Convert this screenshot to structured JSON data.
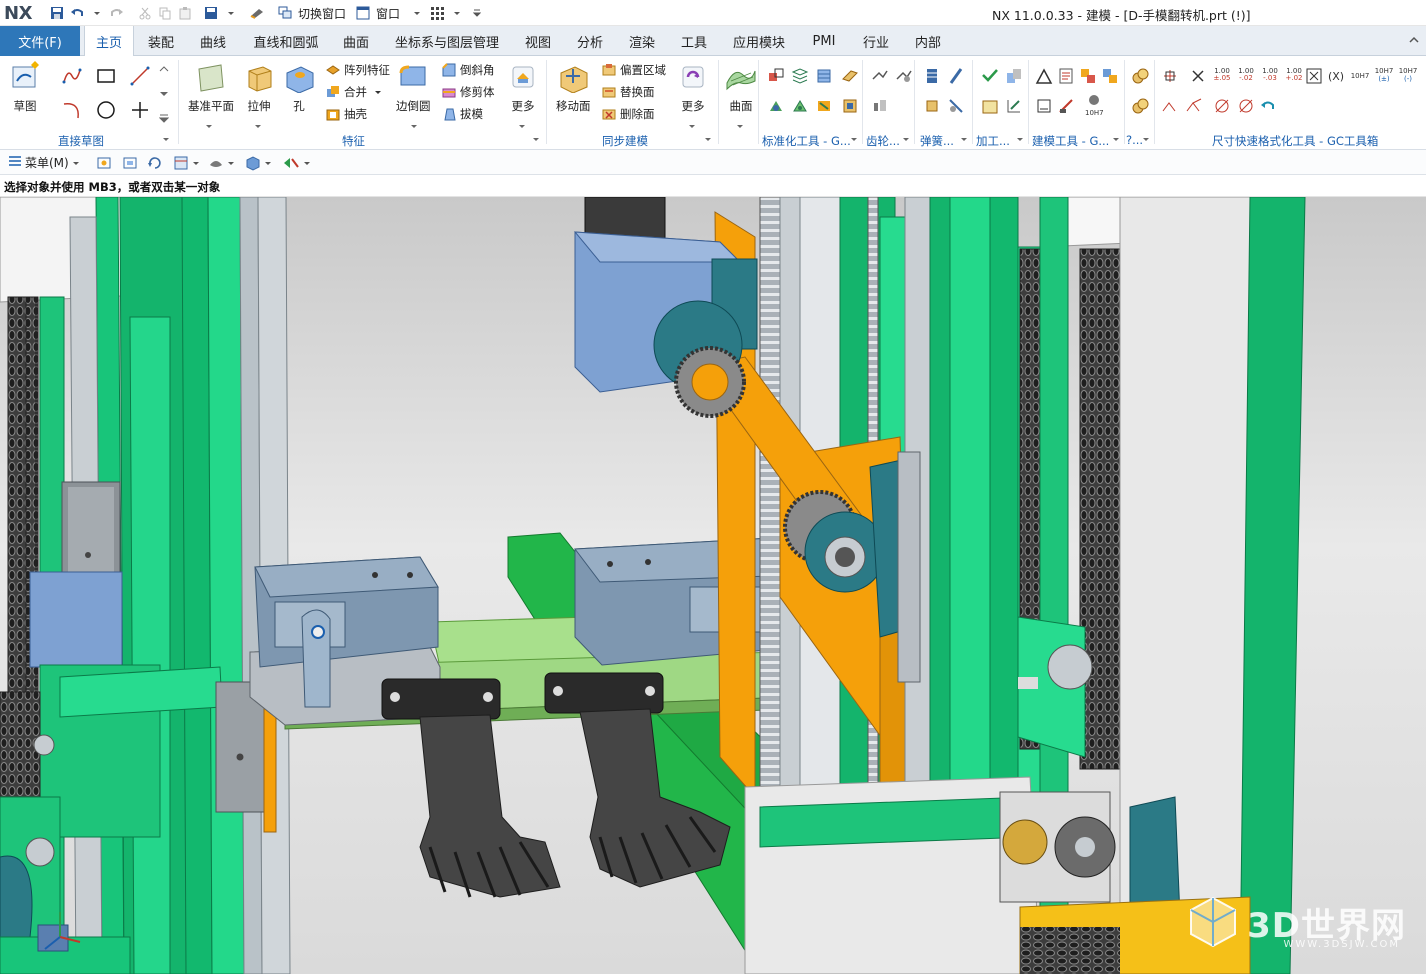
{
  "app": {
    "logo": "NX",
    "window_title": "NX 11.0.0.33 - 建模 - [D-手模翻转机.prt    (!)]"
  },
  "quick_access": {
    "switch_window": "切换窗口",
    "window": "窗口"
  },
  "menu": {
    "file": "文件(F)",
    "tabs": [
      "主页",
      "装配",
      "曲线",
      "直线和圆弧",
      "曲面",
      "坐标系与图层管理",
      "视图",
      "分析",
      "渲染",
      "工具",
      "应用模块",
      "PMI",
      "行业",
      "内部"
    ],
    "active_tab": "主页"
  },
  "ribbon": {
    "sketch": "草图",
    "direct_sketch_group": "直接草图",
    "datum_plane": "基准平面",
    "extrude": "拉伸",
    "hole": "孔",
    "pattern_feature": "阵列特征",
    "unite": "合并",
    "shell": "抽壳",
    "edge_blend": "边倒圆",
    "chamfer": "倒斜角",
    "trim_body": "修剪体",
    "draft": "拔模",
    "more1": "更多",
    "feature_group": "特征",
    "move_face": "移动面",
    "offset_region": "偏置区域",
    "replace_face": "替换面",
    "delete_face": "删除面",
    "more2": "更多",
    "sync_group": "同步建模",
    "surface": "曲面",
    "std_tools_group": "标准化工具 - G...",
    "gear_group": "齿轮...",
    "spring_group": "弹簧...",
    "machining_group": "加工...",
    "modeling_tools_group": "建模工具 - G...",
    "misc_group": "?...",
    "dim_format_group": "尺寸快速格式化工具 - GC工具箱",
    "dim_labels": [
      "1.00",
      "1.00",
      "1.00",
      "1.00",
      "10H7",
      "10H7",
      "10H7"
    ]
  },
  "toolbar2": {
    "menu": "菜单(M)"
  },
  "cue": "选择对象并使用 MB3，或者双击某一对象",
  "watermark": {
    "brand": "3D世界网",
    "url": "WWW.3DSJW.COM"
  },
  "colors": {
    "accent": "#2e77b9",
    "frame_green": "#1fc27a",
    "base_green": "#21b84a",
    "orange": "#f5a00a",
    "steel_blue": "#7f9fc6",
    "gray_part": "#9aa0a6",
    "dark_hand": "#404040",
    "teal_bearing": "#2b7a86"
  }
}
